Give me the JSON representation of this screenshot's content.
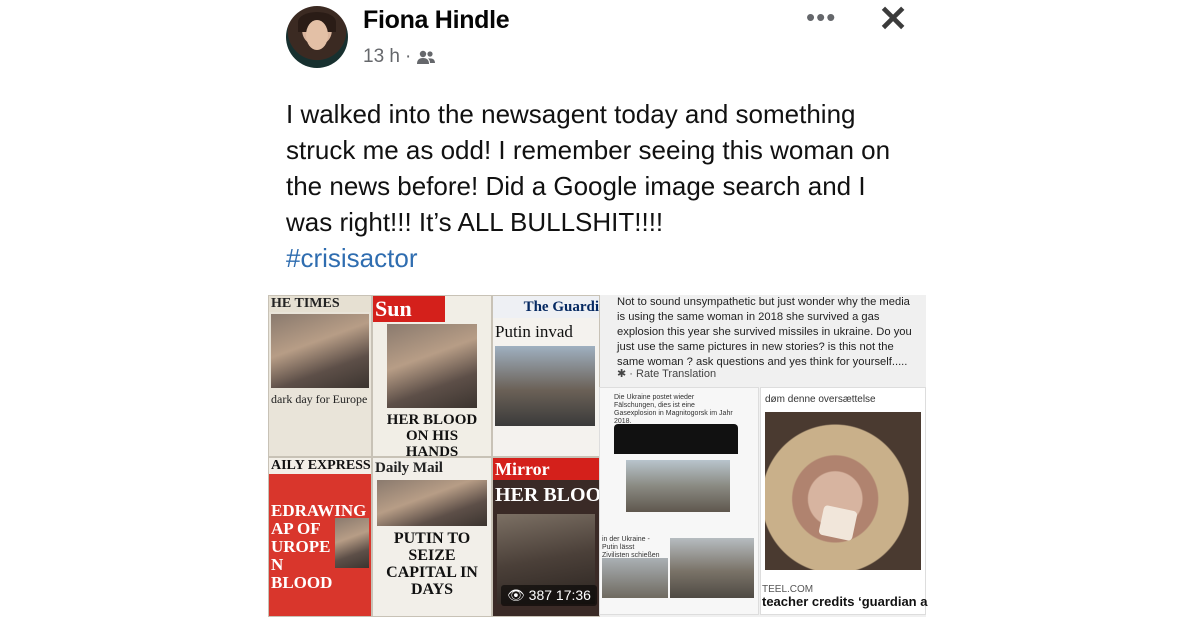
{
  "post": {
    "author": "Fiona Hindle",
    "time": "13 h",
    "audience_icon": "friends-icon",
    "text": "I walked into the newsagent today and something struck me as odd! I remember seeing this woman on the news before! Did a Google image search and I was right!!! It’s ALL BULLSHIT!!!!",
    "hashtag": "#crisisactor"
  },
  "header_actions": {
    "more": "•••",
    "close": "✕"
  },
  "collage": {
    "papers": {
      "times_mast": "HE TIMES",
      "times_head": "dark day for Europe",
      "sun_mast": "Sun",
      "sun_head": "HER BLOOD ON HIS HANDS",
      "guardian_mast": "The Guardi",
      "guardian_head": "Putin invad",
      "express_mast": "AILY EXPRESS",
      "express_head": "EDRAWING AP OF UROPE N BLOOD",
      "mail_mast": "Daily Mail",
      "mail_head": "PUTIN TO SEIZE CAPITAL IN DAYS",
      "mirror_mast": "Mirror",
      "mirror_head": "HER BLOO"
    },
    "comment_text": "Not to sound unsympathetic but just wonder why the media is using the same woman in 2018 she survived a gas explosion this year she survived missiles in ukraine. Do you just use the same pictures in new stories? is this not the same woman ? ask questions and yes think for yourself.....",
    "rate_translation": "· Rate Translation",
    "german_caption": "Die Ukraine postet wieder Fälschungen, dies ist eine Gasexplosion in Magnitogorsk im Jahr 2018.",
    "german_caption2": "in der Ukraine - Putin lässt Zivilisten schießen",
    "danish_header": "døm denne oversættelse",
    "source": "TEEL.COM",
    "credit_line": "teacher credits ‘guardian a",
    "watch_count": "387 17:36"
  },
  "colors": {
    "hashtag": "#2f6db0",
    "meta": "#65676b",
    "sun_red": "#d4201b"
  }
}
